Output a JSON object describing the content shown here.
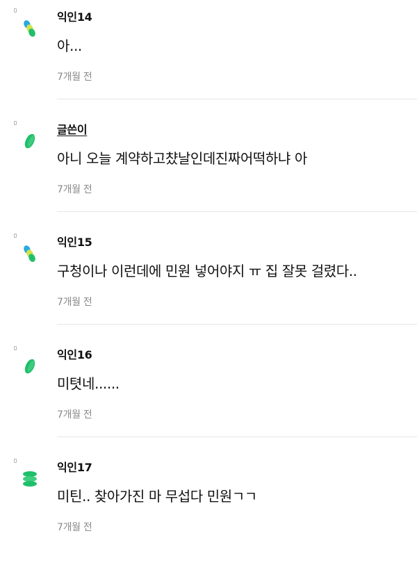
{
  "colors": {
    "avatar_blue": "#29a8e0",
    "avatar_yellow": "#d4e34a",
    "avatar_green": "#1fbf6b",
    "author_text": "#111111",
    "time_text": "#8a8a8a",
    "divider": "#e6e6e6"
  },
  "comments": [
    {
      "author": "익인14",
      "text": "아...",
      "time": "7개월 전",
      "avatar_icon": "multi-color-avatar-icon"
    },
    {
      "author": "글쓴이",
      "text": "아니 오늘 계약하고챴날인데진짜어떡하냐 아",
      "time": "7개월 전",
      "avatar_icon": "green-leaf-avatar-icon",
      "is_author": true
    },
    {
      "author": "익인15",
      "text": "구청이나 이런데에 민원 넣어야지 ㅠ 집 잘못 걸렸다..",
      "time": "7개월 전",
      "avatar_icon": "multi-color-avatar-icon"
    },
    {
      "author": "익인16",
      "text": "미텻네......",
      "time": "7개월 전",
      "avatar_icon": "green-leaf-avatar-icon"
    },
    {
      "author": "익인17",
      "text": "미틴.. 찾아가진 마 무섭다 민원ㄱㄱ",
      "time": "7개월 전",
      "avatar_icon": "green-stack-avatar-icon"
    }
  ]
}
